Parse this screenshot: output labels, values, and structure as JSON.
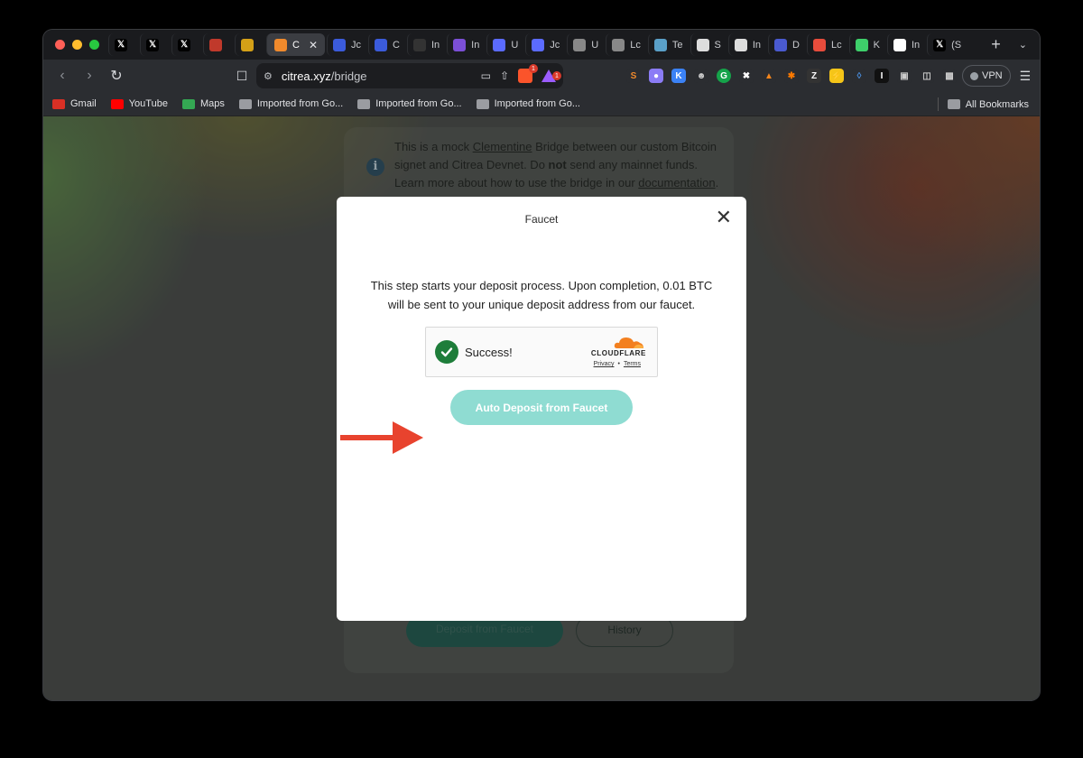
{
  "browser": {
    "tabs": [
      {
        "letter": "",
        "icon": "x-logo-icon",
        "color": "#000000"
      },
      {
        "letter": "",
        "icon": "x-logo-icon",
        "color": "#000000"
      },
      {
        "letter": "",
        "icon": "x-logo-icon",
        "color": "#000000"
      },
      {
        "letter": "",
        "icon": "app-icon",
        "color": "#c0392b"
      },
      {
        "letter": "",
        "icon": "note-icon",
        "color": "#d4a017"
      },
      {
        "letter": "C",
        "icon": "citrea-icon",
        "color": "#f08a2c",
        "active": true
      },
      {
        "letter": "Jc",
        "icon": "bird-icon",
        "color": "#3b5bdb"
      },
      {
        "letter": "C",
        "icon": "bird-icon",
        "color": "#3b5bdb"
      },
      {
        "letter": "In",
        "icon": "user-icon",
        "color": "#333333"
      },
      {
        "letter": "In",
        "icon": "hexagon-icon",
        "color": "#7b4fd6"
      },
      {
        "letter": "U",
        "icon": "circle-icon",
        "color": "#5b6bff"
      },
      {
        "letter": "Jc",
        "icon": "circle-icon",
        "color": "#5b6bff"
      },
      {
        "letter": "U",
        "icon": "gear-circle-icon",
        "color": "#888888"
      },
      {
        "letter": "Lc",
        "icon": "ring-icon",
        "color": "#888888"
      },
      {
        "letter": "Te",
        "icon": "globe-icon",
        "color": "#5aa0c8"
      },
      {
        "letter": "S",
        "icon": "ghost-icon",
        "color": "#dddddd"
      },
      {
        "letter": "In",
        "icon": "info-circle-icon",
        "color": "#dddddd"
      },
      {
        "letter": "D",
        "icon": "disc-icon",
        "color": "#4a5ad0"
      },
      {
        "letter": "Lc",
        "icon": "arrow-up-icon",
        "color": "#e74c3c"
      },
      {
        "letter": "K",
        "icon": "k-icon",
        "color": "#3ecf6a"
      },
      {
        "letter": "In",
        "icon": "i-icon",
        "color": "#ffffff"
      },
      {
        "letter": "(S",
        "icon": "x-logo-icon",
        "color": "#000000"
      }
    ],
    "active_tab_label": "C",
    "address": {
      "host": "citrea.xyz",
      "path": "/bridge"
    },
    "brave_badge": "1",
    "rewards_badge": "1",
    "vpn_label": "VPN",
    "bookmarks": [
      {
        "label": "Gmail",
        "color": "#d93025",
        "icon": "gmail-icon"
      },
      {
        "label": "YouTube",
        "color": "#ff0000",
        "icon": "youtube-icon"
      },
      {
        "label": "Maps",
        "color": "#34a853",
        "icon": "maps-icon"
      },
      {
        "label": "Imported from Go...",
        "icon": "folder-icon"
      },
      {
        "label": "Imported from Go...",
        "icon": "folder-icon"
      },
      {
        "label": "Imported from Go...",
        "icon": "folder-icon"
      }
    ],
    "all_bookmarks": "All Bookmarks"
  },
  "page": {
    "notice": {
      "line1_pre": "This is a mock ",
      "line1_link": "Clementine",
      "line1_post": " Bridge between our custom Bitcoin",
      "line2_pre": "signet and Citrea Devnet. Do ",
      "line2_bold": "not",
      "line2_post": " send any mainnet funds.",
      "line3_pre": "Learn more about how to use the bridge in our ",
      "line3_link": "documentation",
      "line3_post": "."
    },
    "bg_button_deposit": "Deposit from Faucet",
    "bg_button_history": "History"
  },
  "modal": {
    "title": "Faucet",
    "text": "This step starts your deposit process. Upon completion, 0.01 BTC will be sent to your unique deposit address from our faucet.",
    "captcha": {
      "status": "Success!",
      "brand": "CLOUDFLARE",
      "privacy": "Privacy",
      "sep": "•",
      "terms": "Terms"
    },
    "button_label": "Auto Deposit from Faucet"
  },
  "colors": {
    "accent": "#8fdcd2",
    "arrow": "#e8432e",
    "success": "#1e7d3a",
    "cloudflare": "#f38020"
  }
}
